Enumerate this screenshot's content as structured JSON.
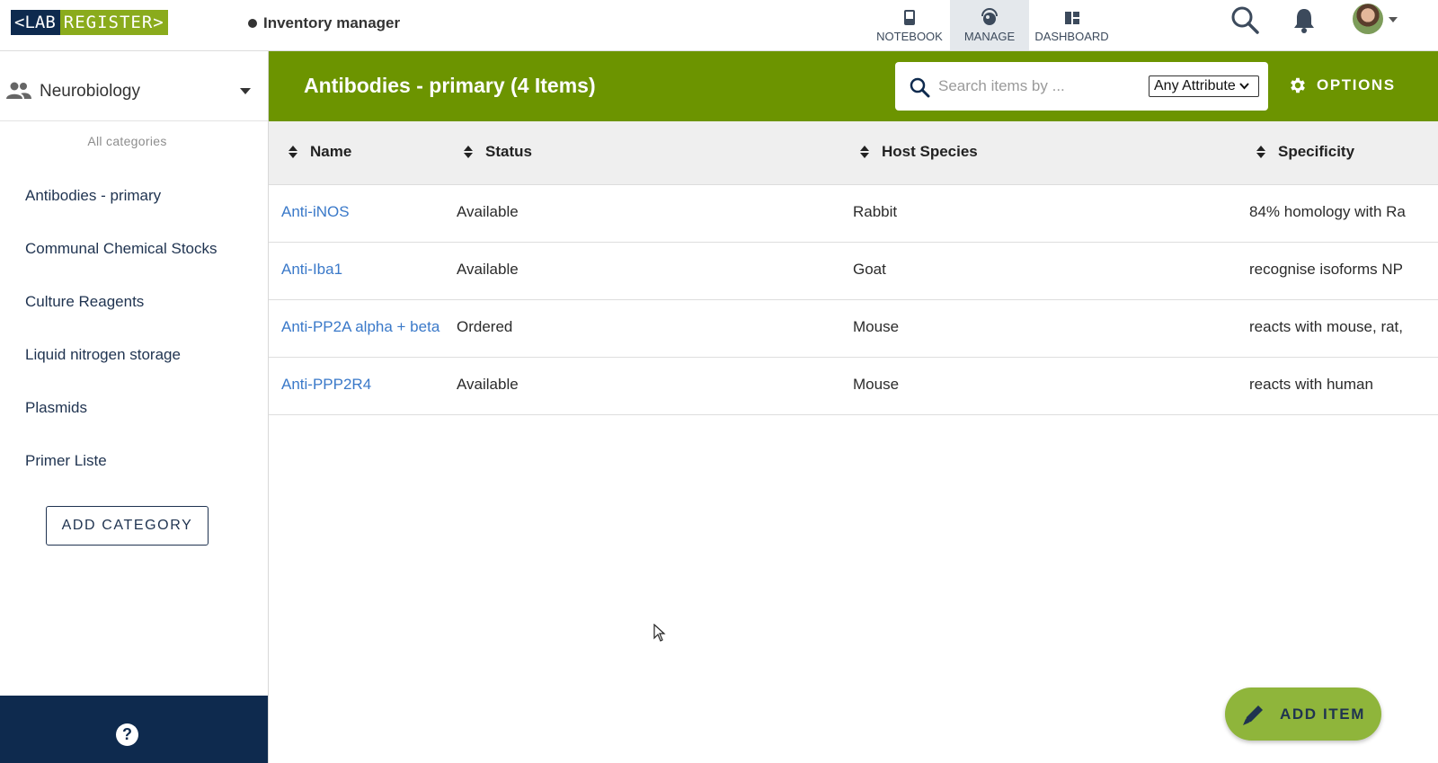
{
  "app": {
    "logo_left": "<LAB",
    "logo_right": "REGISTER>",
    "module_title": "Inventory manager"
  },
  "nav": {
    "tabs": [
      {
        "label": "NOTEBOOK",
        "icon": "notebook-icon",
        "active": false
      },
      {
        "label": "MANAGE",
        "icon": "manage-icon",
        "active": true
      },
      {
        "label": "DASHBOARD",
        "icon": "dashboard-icon",
        "active": false
      }
    ]
  },
  "sidebar": {
    "group": "Neurobiology",
    "all_categories": "All categories",
    "categories": [
      {
        "label": "Antibodies - primary"
      },
      {
        "label": "Communal Chemical Stocks"
      },
      {
        "label": "Culture Reagents"
      },
      {
        "label": "Liquid nitrogen storage"
      },
      {
        "label": "Plasmids"
      },
      {
        "label": "Primer Liste"
      }
    ],
    "add_category": "ADD CATEGORY",
    "help": "?"
  },
  "main": {
    "title": "Antibodies - primary (4 Items)",
    "search": {
      "placeholder": "Search items by ...",
      "attribute": "Any Attribute"
    },
    "options": "OPTIONS",
    "columns": [
      "Name",
      "Status",
      "Host Species",
      "Specificity"
    ],
    "rows": [
      {
        "name": "Anti-iNOS",
        "status": "Available",
        "host": "Rabbit",
        "spec": "84% homology with Ra"
      },
      {
        "name": "Anti-Iba1",
        "status": "Available",
        "host": "Goat",
        "spec": "recognise isoforms NP"
      },
      {
        "name": "Anti-PP2A alpha + beta",
        "status": "Ordered",
        "host": "Mouse",
        "spec": "reacts with mouse, rat,"
      },
      {
        "name": "Anti-PPP2R4",
        "status": "Available",
        "host": "Mouse",
        "spec": "reacts with human"
      }
    ],
    "add_item": "ADD ITEM"
  },
  "colors": {
    "header_green": "#6c9400",
    "navy": "#0e2a4e",
    "link_blue": "#3a79c9",
    "fab_green": "#8fb53b"
  }
}
